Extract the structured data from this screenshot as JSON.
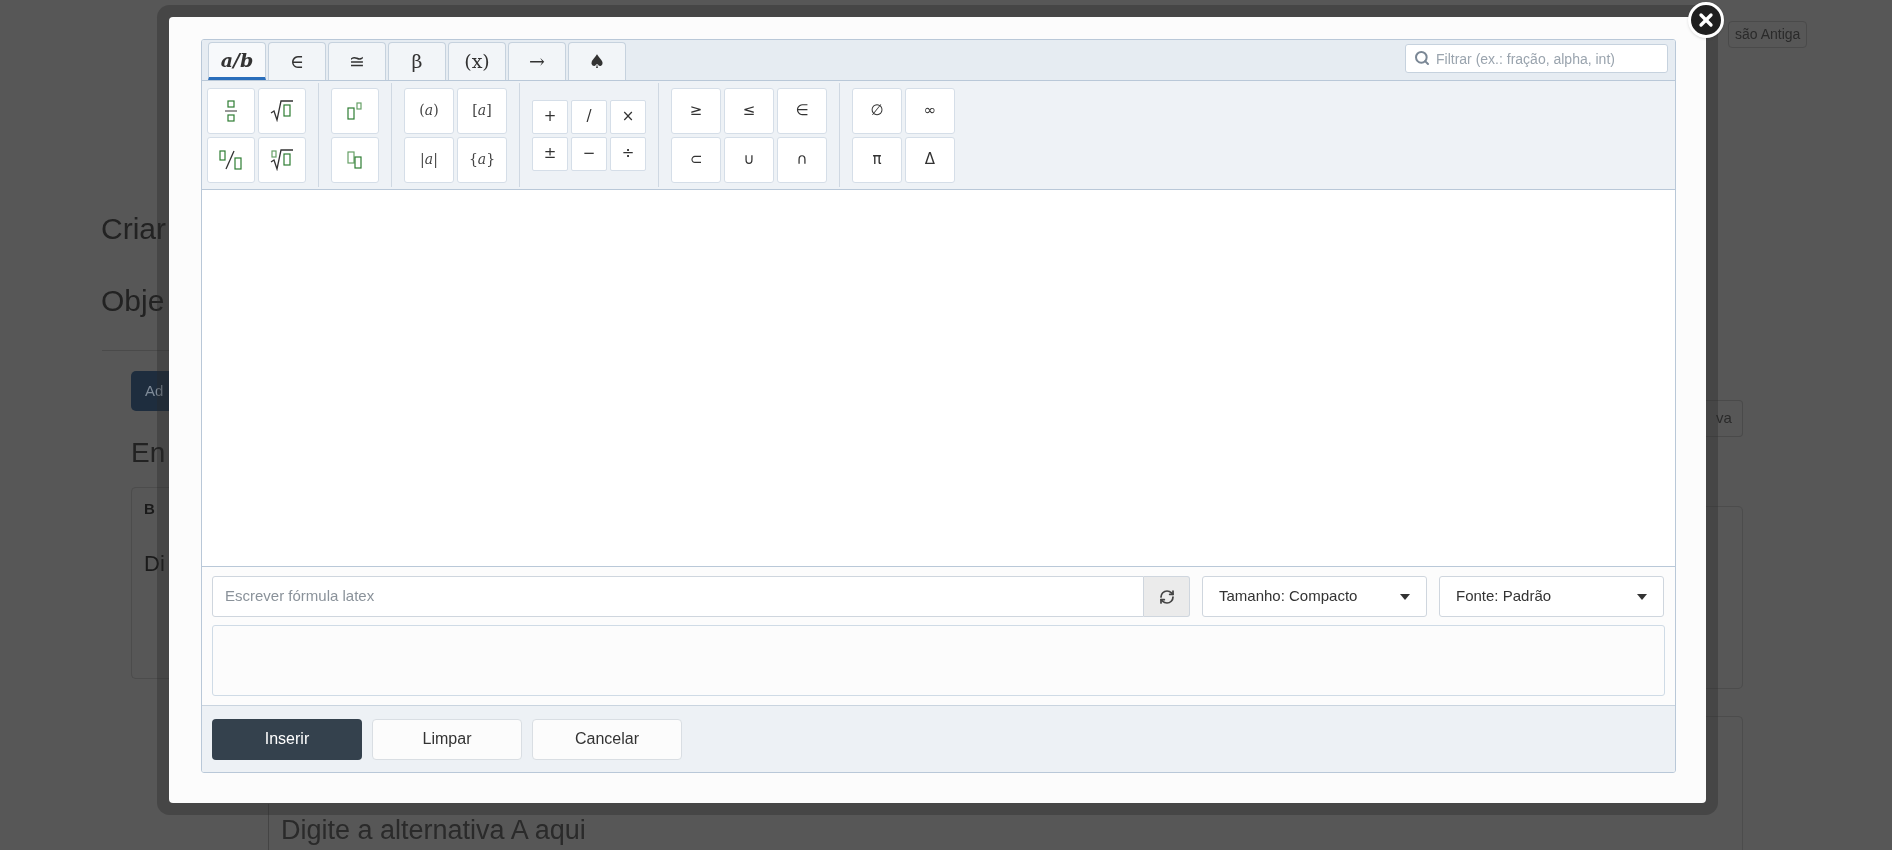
{
  "background_page": {
    "heading": "Criar",
    "subheading": "Obje",
    "add_button": "Ad",
    "section_title": "En",
    "card_label": "B",
    "card_text": "Di",
    "old_version_button": "são Antiga",
    "side_button": "va",
    "answer_placeholder": "Digite a alternativa A aqui"
  },
  "dialog": {
    "tabs": [
      {
        "label": "a/b",
        "selected": true
      },
      {
        "label": "∈",
        "selected": false
      },
      {
        "label": "≅",
        "selected": false
      },
      {
        "label": "β",
        "selected": false
      },
      {
        "label": "(x)",
        "selected": false
      },
      {
        "label": "→",
        "selected": false
      },
      {
        "label": "♠",
        "selected": false
      }
    ],
    "filter": {
      "placeholder": "Filtrar (ex.: fração, alpha, int)"
    },
    "symbol_groups": [
      {
        "kind": "bracket",
        "symbols": [
          "(*a*)",
          "[*a*]",
          "|*a*|",
          "{*a*}"
        ]
      },
      {
        "kind": "small",
        "symbols": [
          "+",
          "/",
          "×",
          "±",
          "−",
          "÷"
        ]
      },
      {
        "kind": "large",
        "symbols": [
          "≥",
          "≤",
          "∈",
          "⊂",
          "∪",
          "∩"
        ]
      },
      {
        "kind": "large",
        "symbols": [
          "∅",
          "∞",
          "π",
          "Δ"
        ]
      }
    ],
    "latex_input": {
      "placeholder": "Escrever fórmula latex"
    },
    "selects": [
      {
        "value": "Tamanho: Compacto"
      },
      {
        "value": "Fonte: Padrão"
      }
    ],
    "buttons": [
      {
        "label": "Inserir",
        "kind": "primary"
      },
      {
        "label": "Limpar",
        "kind": "default"
      },
      {
        "label": "Cancelar",
        "kind": "default"
      }
    ]
  }
}
